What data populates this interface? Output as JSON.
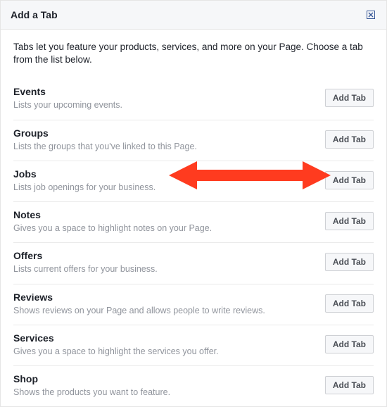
{
  "header": {
    "title": "Add a Tab"
  },
  "intro": "Tabs let you feature your products, services, and more on your Page. Choose a tab from the list below.",
  "add_label": "Add Tab",
  "tabs": [
    {
      "name": "Events",
      "desc": "Lists your upcoming events."
    },
    {
      "name": "Groups",
      "desc": "Lists the groups that you've linked to this Page."
    },
    {
      "name": "Jobs",
      "desc": "Lists job openings for your business."
    },
    {
      "name": "Notes",
      "desc": "Gives you a space to highlight notes on your Page."
    },
    {
      "name": "Offers",
      "desc": "Lists current offers for your business."
    },
    {
      "name": "Reviews",
      "desc": "Shows reviews on your Page and allows people to write reviews."
    },
    {
      "name": "Services",
      "desc": "Gives you a space to highlight the services you offer."
    },
    {
      "name": "Shop",
      "desc": "Shows the products you want to feature."
    }
  ],
  "arrow": {
    "color": "#ff3b1f"
  }
}
